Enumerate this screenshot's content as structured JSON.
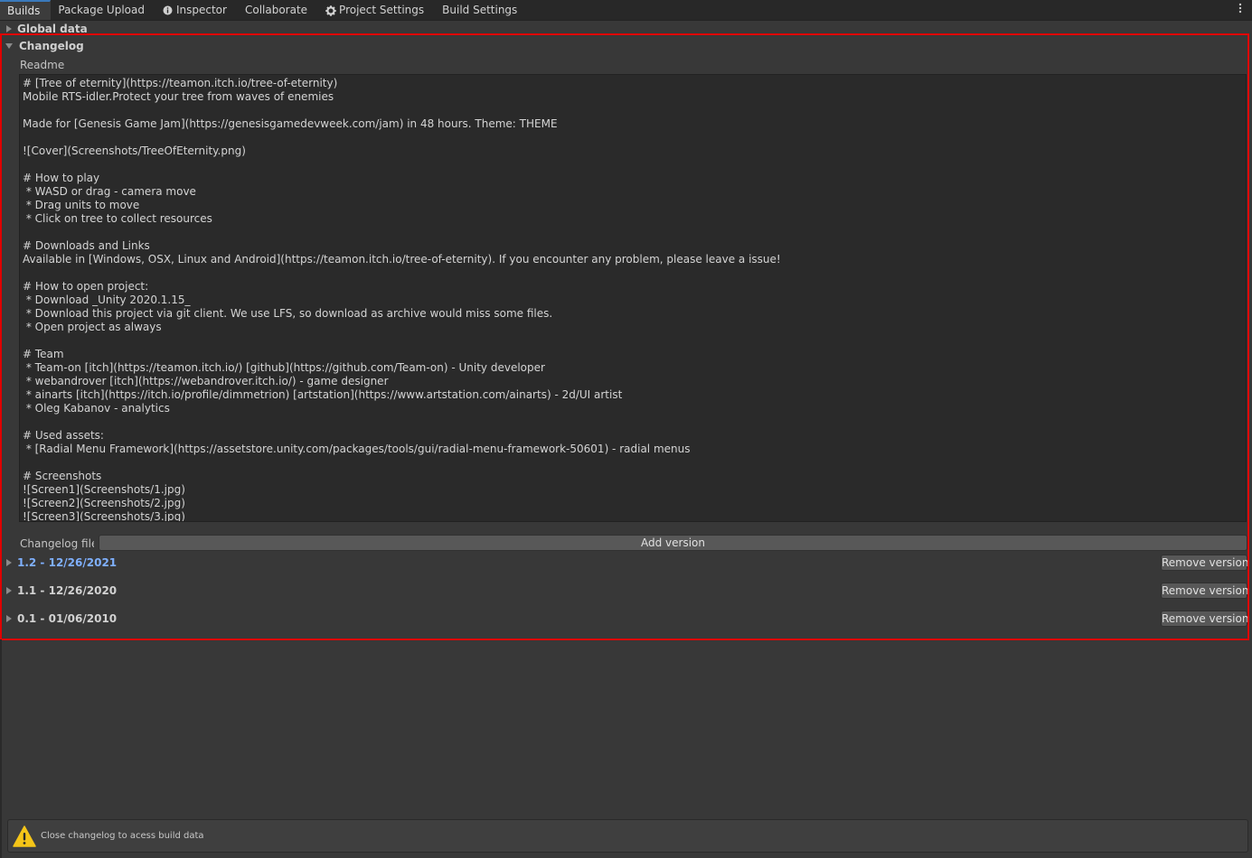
{
  "tabs": [
    {
      "label": "Builds",
      "icon": ""
    },
    {
      "label": "Package Upload",
      "icon": ""
    },
    {
      "label": "Inspector",
      "icon": "info-icon"
    },
    {
      "label": "Collaborate",
      "icon": ""
    },
    {
      "label": "Project Settings",
      "icon": "gear-icon"
    },
    {
      "label": "Build Settings",
      "icon": ""
    }
  ],
  "sections": {
    "global_data": "Global data",
    "changelog": "Changelog"
  },
  "readme": {
    "label": "Readme",
    "text": "# [Tree of eternity](https://teamon.itch.io/tree-of-eternity)\nMobile RTS-idler.Protect your tree from waves of enemies\n\nMade for [Genesis Game Jam](https://genesisgamedevweek.com/jam) in 48 hours. Theme: THEME\n\n![Cover](Screenshots/TreeOfEternity.png)\n\n# How to play\n * WASD or drag - camera move\n * Drag units to move\n * Click on tree to collect resources\n\n# Downloads and Links\nAvailable in [Windows, OSX, Linux and Android](https://teamon.itch.io/tree-of-eternity). If you encounter any problem, please leave a issue!\n\n# How to open project:\n * Download _Unity 2020.1.15_\n * Download this project via git client. We use LFS, so download as archive would miss some files.\n * Open project as always\n\n# Team\n * Team-on [itch](https://teamon.itch.io/) [github](https://github.com/Team-on) - Unity developer\n * webandrover [itch](https://webandrover.itch.io/) - game designer\n * ainarts [itch](https://itch.io/profile/dimmetrion) [artstation](https://www.artstation.com/ainarts) - 2d/UI artist\n * Oleg Kabanov - analytics\n\n# Used assets:\n * [Radial Menu Framework](https://assetstore.unity.com/packages/tools/gui/radial-menu-framework-50601) - radial menus\n\n# Screenshots\n![Screen1](Screenshots/1.jpg)\n![Screen2](Screenshots/2.jpg)\n![Screen3](Screenshots/3.jpg)"
  },
  "changelog_file_label": "Changelog file",
  "add_version_label": "Add version",
  "versions": [
    {
      "label": "1.2 - 12/26/2021",
      "remove_label": "Remove version",
      "highlight": true
    },
    {
      "label": "1.1 - 12/26/2020",
      "remove_label": "Remove version",
      "highlight": false
    },
    {
      "label": "0.1 - 01/06/2010",
      "remove_label": "Remove version",
      "highlight": false
    }
  ],
  "help": {
    "message": "Close changelog to acess build data",
    "icon": "warning-icon",
    "icon_color": "#f5c518"
  },
  "colors": {
    "accent_tab": "#3a79bb",
    "highlight_box": "#e00000",
    "version_highlight": "#7fb0ff"
  }
}
